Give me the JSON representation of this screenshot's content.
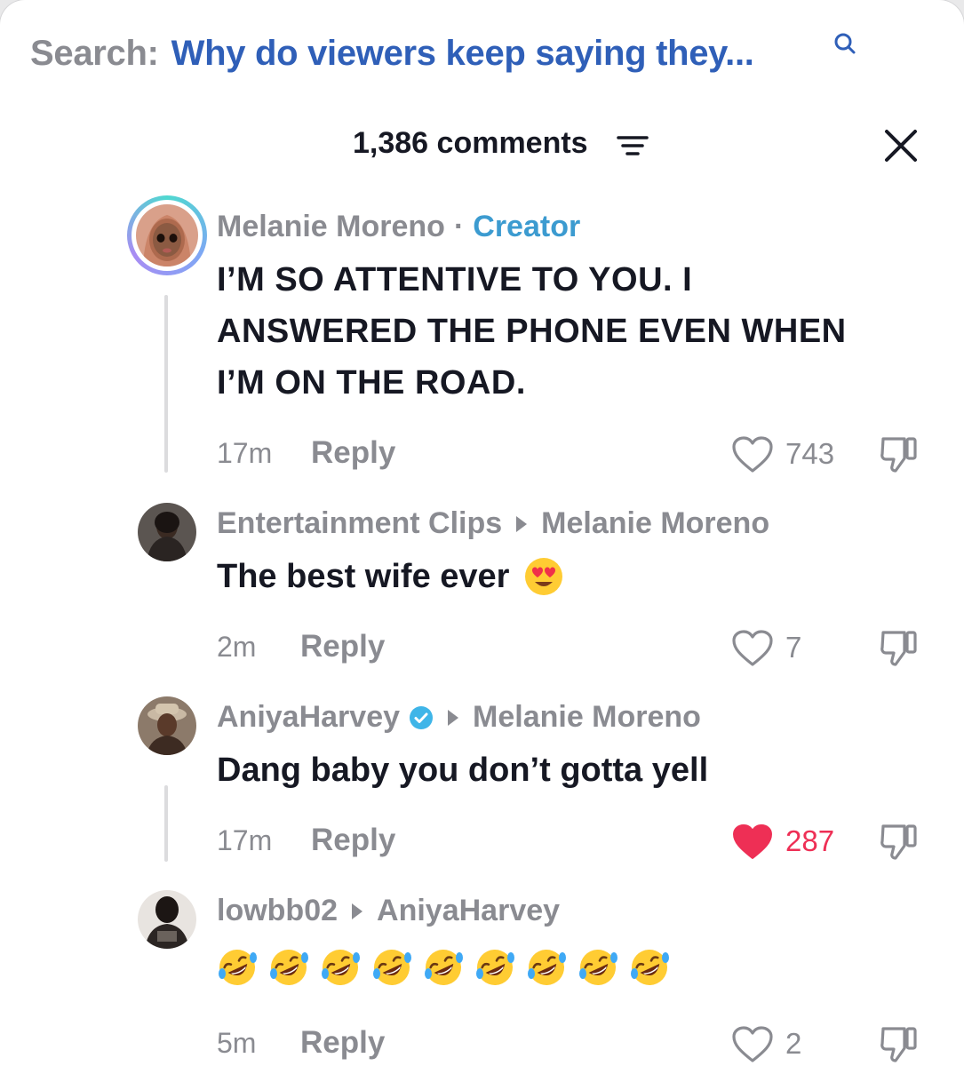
{
  "search": {
    "label": "Search:",
    "query": "Why do viewers keep saying they..."
  },
  "header": {
    "count": "1,386 comments"
  },
  "reply_label": "Reply",
  "comments": [
    {
      "author": "Melanie Moreno",
      "separator": "·",
      "tag": "Creator",
      "lines": [
        "I’M SO ATTENTIVE TO YOU. I",
        "ANSWERED THE PHONE EVEN WHEN",
        "I’M ON THE ROAD."
      ],
      "time": "17m",
      "likes": "743",
      "liked": false
    },
    {
      "author": "Entertainment Clips",
      "reply_to": "Melanie Moreno",
      "text": "The best wife ever",
      "emoji": "heart-eyes",
      "time": "2m",
      "likes": "7",
      "liked": false
    },
    {
      "author": "AniyaHarvey",
      "verified": true,
      "reply_to": "Melanie Moreno",
      "text": "Dang baby you don’t gotta yell",
      "time": "17m",
      "likes": "287",
      "liked": true
    },
    {
      "author": "lowbb02",
      "reply_to": "AniyaHarvey",
      "emoji": "rolling-on-floor-laughing",
      "emoji_count": 9,
      "time": "5m",
      "likes": "2",
      "liked": false
    }
  ],
  "colors": {
    "link_blue": "#2f5fb8",
    "creator_blue": "#3c9bd0",
    "like_red": "#ee2f55",
    "muted": "#8a8b91",
    "text": "#161823"
  }
}
